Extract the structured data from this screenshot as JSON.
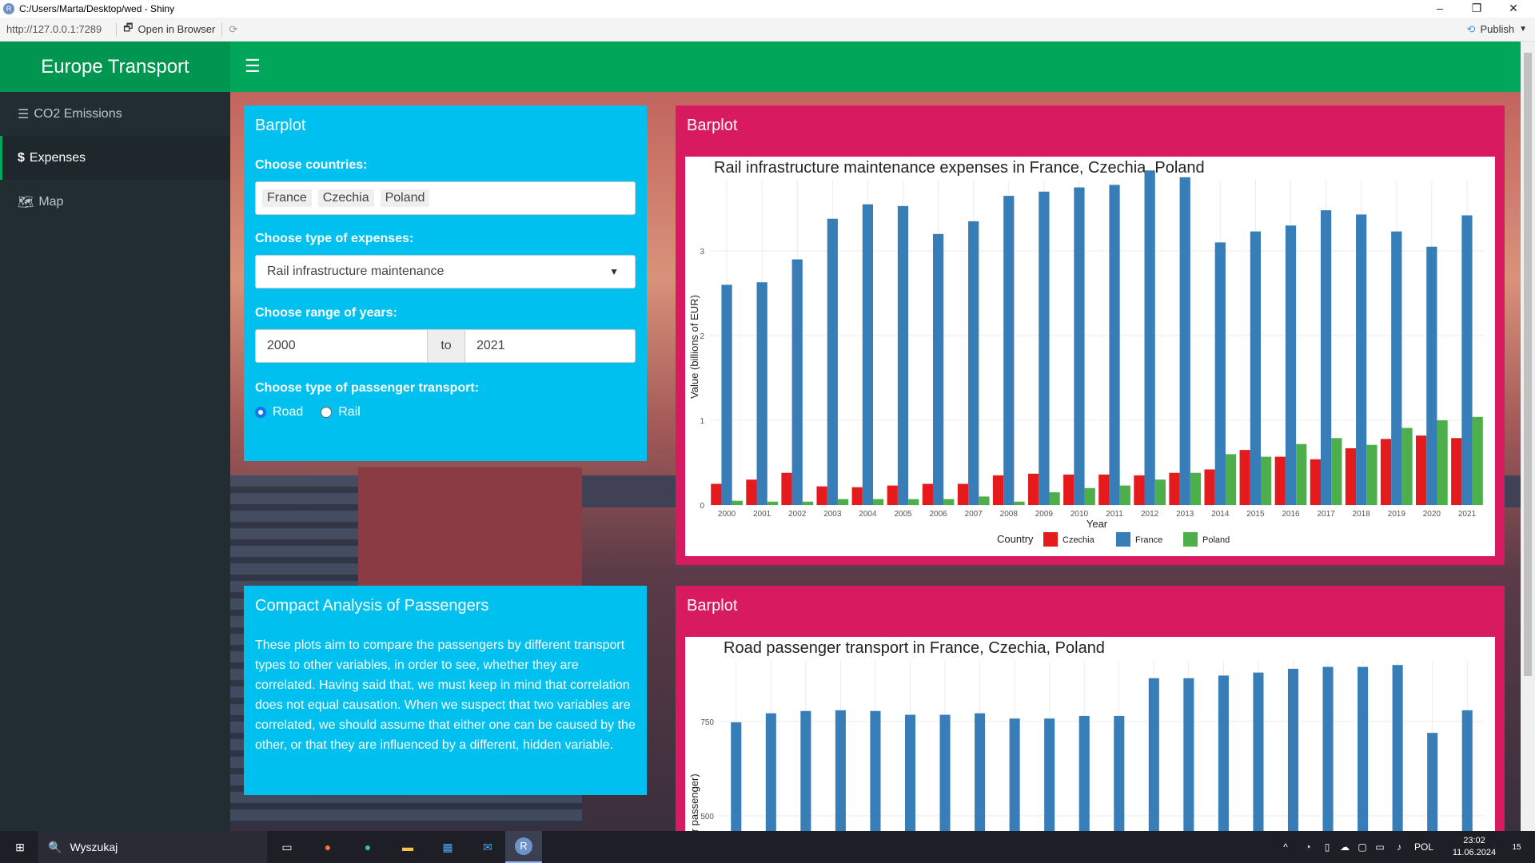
{
  "window": {
    "title": "C:/Users/Marta/Desktop/wed - Shiny",
    "url": "http://127.0.0.1:7289",
    "open_in_browser": "Open in Browser",
    "publish": "Publish"
  },
  "header": {
    "brand": "Europe Transport"
  },
  "sidebar": {
    "items": [
      {
        "label": "CO2 Emissions",
        "icon": "bars-icon"
      },
      {
        "label": "Expenses",
        "icon": "dollar-icon"
      },
      {
        "label": "Map",
        "icon": "map-icon"
      }
    ]
  },
  "controls": {
    "title": "Barplot",
    "countries_label": "Choose countries:",
    "countries": [
      "France",
      "Czechia",
      "Poland"
    ],
    "expense_label": "Choose type of expenses:",
    "expense_value": "Rail infrastructure maintenance",
    "years_label": "Choose range of years:",
    "year_from": "2000",
    "year_to_sep": "to",
    "year_to": "2021",
    "transport_label": "Choose type of passenger transport:",
    "transport_options": [
      "Road",
      "Rail"
    ],
    "transport_selected": "Road"
  },
  "analysis": {
    "title": "Compact Analysis of Passengers",
    "text": "These plots aim to compare the passengers by different transport types to other variables, in order to see, whether they are correlated. Having said that, we must keep in mind that correlation does not equal causation. When we suspect that two variables are correlated, we should assume that either one can be caused by the other, or that they are influenced by a different, hidden variable."
  },
  "plot1_box_title": "Barplot",
  "plot2_box_title": "Barplot",
  "chart_data": [
    {
      "type": "bar",
      "title": "Rail infrastructure maintenance expenses in France, Czechia, Poland",
      "xlabel": "Year",
      "ylabel": "Value (billions of EUR)",
      "ylim": [
        0,
        4
      ],
      "yticks": [
        0,
        1,
        2,
        3
      ],
      "legend_title": "Country",
      "legend_position": "bottom",
      "categories": [
        "2000",
        "2001",
        "2002",
        "2003",
        "2004",
        "2005",
        "2006",
        "2007",
        "2008",
        "2009",
        "2010",
        "2011",
        "2012",
        "2013",
        "2014",
        "2015",
        "2016",
        "2017",
        "2018",
        "2019",
        "2020",
        "2021"
      ],
      "series": [
        {
          "name": "Czechia",
          "color": "#e41a1c",
          "values": [
            0.25,
            0.3,
            0.38,
            0.22,
            0.21,
            0.23,
            0.25,
            0.25,
            0.35,
            0.37,
            0.36,
            0.36,
            0.35,
            0.38,
            0.42,
            0.65,
            0.57,
            0.54,
            0.67,
            0.78,
            0.82,
            0.79
          ]
        },
        {
          "name": "France",
          "color": "#377eb8",
          "values": [
            2.6,
            2.63,
            2.9,
            3.38,
            3.55,
            3.53,
            3.2,
            3.35,
            3.65,
            3.7,
            3.75,
            3.78,
            3.95,
            3.87,
            3.1,
            3.23,
            3.3,
            3.48,
            3.43,
            3.23,
            3.05,
            3.42
          ]
        },
        {
          "name": "Poland",
          "color": "#4daf4a",
          "values": [
            0.05,
            0.04,
            0.04,
            0.07,
            0.07,
            0.07,
            0.07,
            0.1,
            0.04,
            0.15,
            0.2,
            0.23,
            0.3,
            0.38,
            0.6,
            0.57,
            0.72,
            0.79,
            0.71,
            0.91,
            1.0,
            1.04
          ]
        }
      ]
    },
    {
      "type": "bar",
      "title": "Road passenger transport in France, Czechia, Poland",
      "ylabel": "per passenger)",
      "yticks": [
        500,
        750
      ],
      "categories": [
        "2000",
        "2001",
        "2002",
        "2003",
        "2004",
        "2005",
        "2006",
        "2007",
        "2008",
        "2009",
        "2010",
        "2011",
        "2012",
        "2013",
        "2014",
        "2015",
        "2016",
        "2017",
        "2018",
        "2019",
        "2020",
        "2021"
      ],
      "series": [
        {
          "name": "France",
          "color": "#377eb8",
          "values": [
            748,
            772,
            778,
            780,
            778,
            768,
            768,
            772,
            758,
            758,
            765,
            765,
            865,
            865,
            872,
            880,
            890,
            895,
            895,
            900,
            720,
            780
          ]
        }
      ]
    }
  ],
  "taskbar": {
    "search": "Wyszukaj",
    "lang": "POL",
    "time": "23:02",
    "date": "11.06.2024",
    "notifications": "15"
  }
}
